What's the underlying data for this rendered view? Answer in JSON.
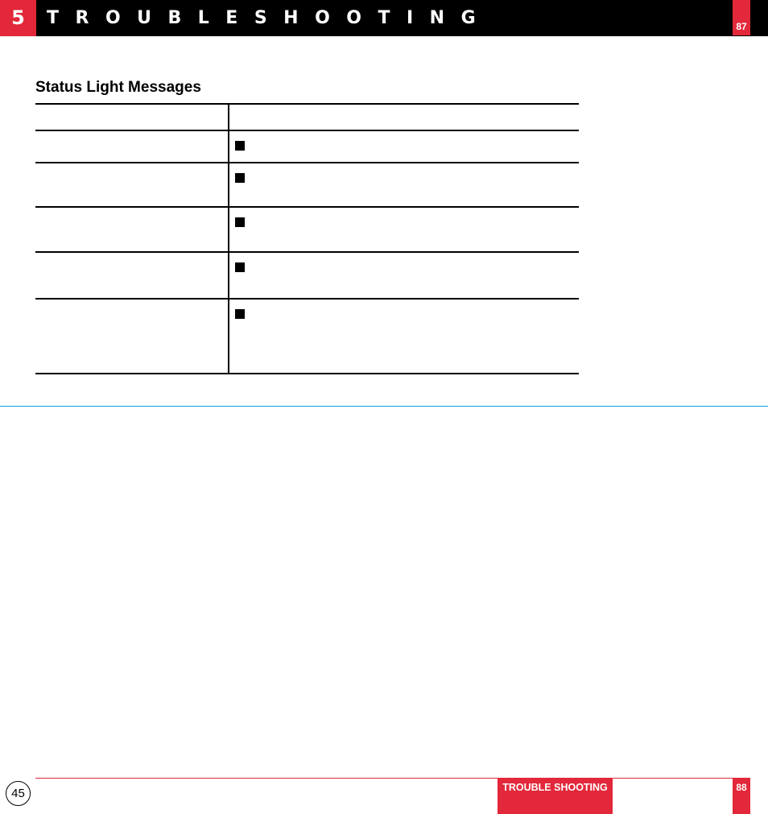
{
  "header": {
    "chapter_number": "5",
    "chapter_title": "TROUBLESHOOTING",
    "page_tag": "87"
  },
  "section": {
    "title": "Status Light Messages"
  },
  "table": {
    "columns": [
      "",
      ""
    ],
    "rows": [
      {
        "label": "",
        "bullet": "square-bullet",
        "text": ""
      },
      {
        "label": "",
        "bullet": "square-bullet",
        "text": ""
      },
      {
        "label": "",
        "bullet": "square-bullet",
        "text": ""
      },
      {
        "label": "",
        "bullet": "square-bullet",
        "text": ""
      },
      {
        "label": "",
        "bullet": "square-bullet",
        "text": ""
      }
    ]
  },
  "footer": {
    "page_number": "45",
    "section_label": "TROUBLE SHOOTING",
    "page_tag": "88"
  },
  "colors": {
    "accent_red": "#e2283a",
    "divider_blue": "#0aa3dc",
    "header_bg": "#000000"
  }
}
